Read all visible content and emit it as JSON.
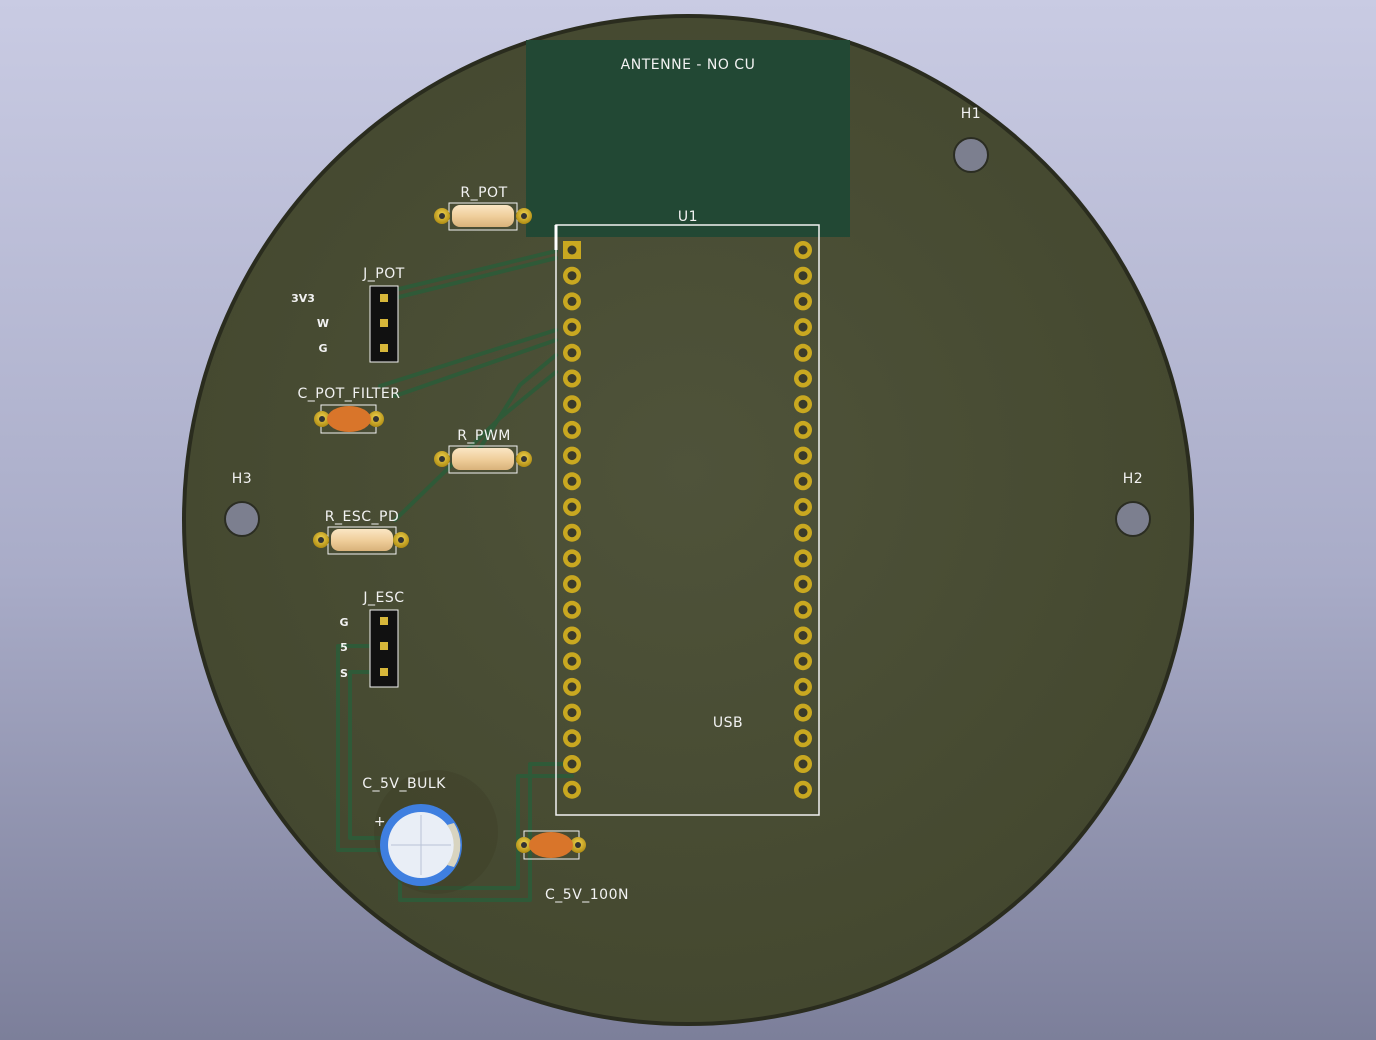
{
  "board": {
    "antenna_label": "ANTENNE - NO CU",
    "module_ref": "U1",
    "usb_label": "USB",
    "pins_per_side": 22
  },
  "holes": [
    {
      "ref": "H1"
    },
    {
      "ref": "H2"
    },
    {
      "ref": "H3"
    }
  ],
  "components": {
    "r_pot": "R_POT",
    "j_pot": "J_POT",
    "j_pot_pins": [
      "3V3",
      "W",
      "G"
    ],
    "c_pot_filter": "C_POT_FILTER",
    "r_pwm": "R_PWM",
    "r_esc_pd": "R_ESC_PD",
    "j_esc": "J_ESC",
    "j_esc_pins": [
      "G",
      "5",
      "S"
    ],
    "c_5v_bulk": "C_5V_BULK",
    "c_5v_bulk_polarity": "+",
    "c_5v_100n": "C_5V_100N"
  },
  "colors": {
    "board": "#4c4f38",
    "board_edge": "#2a2c1e",
    "keepout": "#224834",
    "trace": "#2f5a38",
    "silkscreen": "#f2f2f2",
    "pad": "#c9a820",
    "resistor_body": "#f3d4a4",
    "ceramic_cap": "#d9752a",
    "electrolytic": "#3f7fe0"
  }
}
